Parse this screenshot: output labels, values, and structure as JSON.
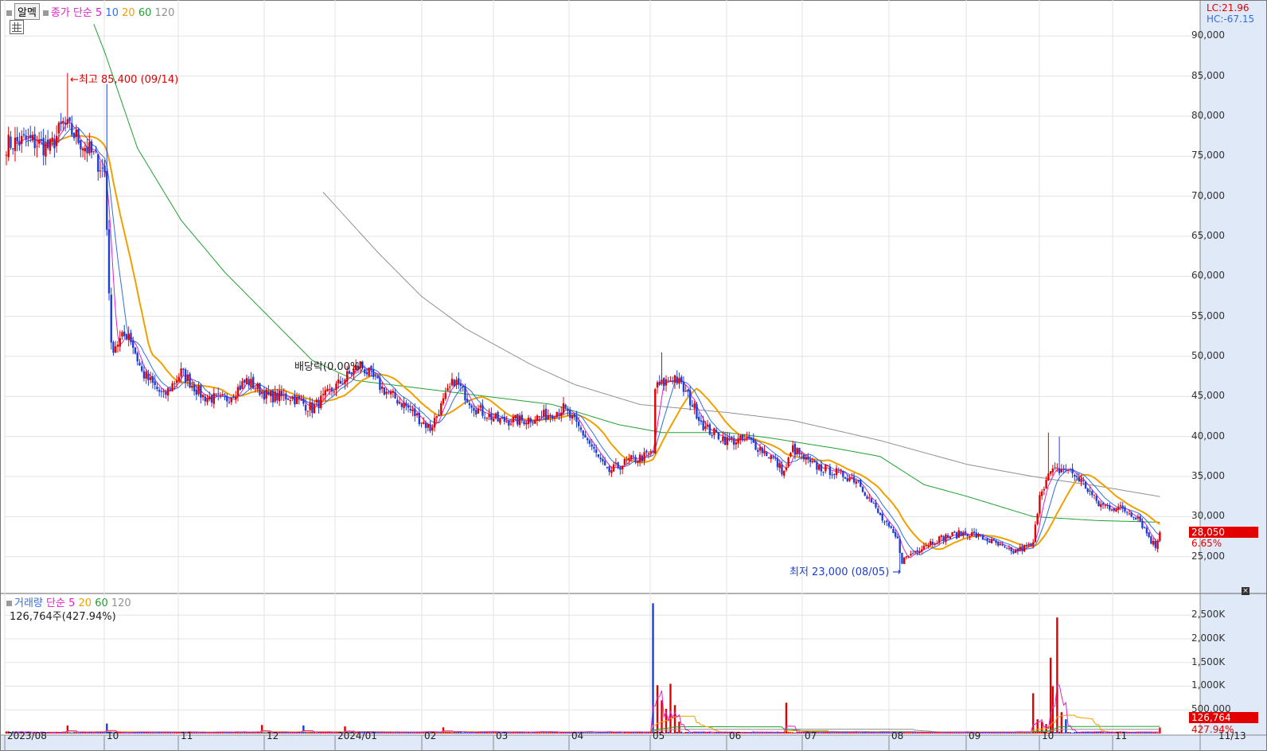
{
  "price_header": {
    "settings_label": "알멕",
    "title": "종가 단순",
    "ma_5": "5",
    "ma_10": "10",
    "ma_20": "20",
    "ma_60": "60",
    "ma_120": "120"
  },
  "volume_header": {
    "title": "거래량",
    "type": "단순",
    "ma_5": "5",
    "ma_20": "20",
    "ma_60": "60",
    "ma_120": "120",
    "latest": "126,764주(427.94%)"
  },
  "corner_stats": {
    "lc": "LC:21.96",
    "hc": "HC:-67.15"
  },
  "annotations": {
    "high": "←최고 85,400 (09/14)",
    "low": "최저 23,000 (08/05) →",
    "dividend": "배당락(0.00%)"
  },
  "current": {
    "price": "28,050",
    "change": "6.65%",
    "volume": "126,764",
    "volume_ratio": "427.94%"
  },
  "colors": {
    "up": "#e30000",
    "down": "#1d3fd6",
    "ma5": "#e020c8",
    "ma10": "#2f6fe0",
    "ma20": "#f0a000",
    "ma60": "#20a030",
    "ma120": "#909090",
    "axis_bg": "#dfe9f7"
  },
  "chart_data": {
    "type": "candlestick",
    "price_axis": {
      "ticks": [
        "90,000",
        "85,000",
        "80,000",
        "75,000",
        "70,000",
        "65,000",
        "60,000",
        "55,000",
        "50,000",
        "45,000",
        "40,000",
        "35,000",
        "30,000",
        "25,000"
      ],
      "ylim": [
        20600,
        94400
      ]
    },
    "volume_axis": {
      "ticks": [
        "2,500K",
        "2,000K",
        "1,500K",
        "1,000K",
        "500,000"
      ],
      "ylim": [
        0,
        2890000
      ]
    },
    "x_ticks": [
      "2023/08",
      "10",
      "11",
      "12",
      "2024/01",
      "02",
      "03",
      "04",
      "05",
      "06",
      "07",
      "08",
      "09",
      "10",
      "11",
      "11/13"
    ],
    "anchors": [
      {
        "d": 0,
        "c": 76500
      },
      {
        "d": 10,
        "c": 77000
      },
      {
        "d": 20,
        "c": 76000
      },
      {
        "d": 26,
        "c": 79000
      },
      {
        "d": 30,
        "c": 78000
      },
      {
        "d": 40,
        "c": 75000
      },
      {
        "d": 45,
        "c": 73000
      },
      {
        "d": 46,
        "c": 66000
      },
      {
        "d": 48,
        "c": 51000
      },
      {
        "d": 56,
        "c": 53000
      },
      {
        "d": 62,
        "c": 48000
      },
      {
        "d": 72,
        "c": 45000
      },
      {
        "d": 80,
        "c": 48000
      },
      {
        "d": 90,
        "c": 45000
      },
      {
        "d": 100,
        "c": 44500
      },
      {
        "d": 110,
        "c": 47000
      },
      {
        "d": 120,
        "c": 45000
      },
      {
        "d": 130,
        "c": 45000
      },
      {
        "d": 140,
        "c": 43500
      },
      {
        "d": 150,
        "c": 46000
      },
      {
        "d": 162,
        "c": 49000
      },
      {
        "d": 172,
        "c": 46000
      },
      {
        "d": 182,
        "c": 44000
      },
      {
        "d": 194,
        "c": 41000
      },
      {
        "d": 205,
        "c": 47000
      },
      {
        "d": 215,
        "c": 43500
      },
      {
        "d": 225,
        "c": 42000
      },
      {
        "d": 235,
        "c": 42000
      },
      {
        "d": 245,
        "c": 42500
      },
      {
        "d": 255,
        "c": 43500
      },
      {
        "d": 265,
        "c": 40000
      },
      {
        "d": 275,
        "c": 35500
      },
      {
        "d": 285,
        "c": 37000
      },
      {
        "d": 292,
        "c": 37500
      },
      {
        "d": 296,
        "c": 38000
      },
      {
        "d": 297,
        "c": 46000
      },
      {
        "d": 306,
        "c": 47500
      },
      {
        "d": 312,
        "c": 45000
      },
      {
        "d": 320,
        "c": 41000
      },
      {
        "d": 330,
        "c": 39500
      },
      {
        "d": 340,
        "c": 39500
      },
      {
        "d": 350,
        "c": 37500
      },
      {
        "d": 356,
        "c": 35500
      },
      {
        "d": 360,
        "c": 38500
      },
      {
        "d": 368,
        "c": 36500
      },
      {
        "d": 380,
        "c": 35500
      },
      {
        "d": 390,
        "c": 34500
      },
      {
        "d": 400,
        "c": 30000
      },
      {
        "d": 408,
        "c": 27000
      },
      {
        "d": 410,
        "c": 24500
      },
      {
        "d": 420,
        "c": 26500
      },
      {
        "d": 430,
        "c": 27500
      },
      {
        "d": 440,
        "c": 28000
      },
      {
        "d": 450,
        "c": 27000
      },
      {
        "d": 460,
        "c": 25500
      },
      {
        "d": 470,
        "c": 26500
      },
      {
        "d": 473,
        "c": 33000
      },
      {
        "d": 478,
        "c": 35500
      },
      {
        "d": 485,
        "c": 36000
      },
      {
        "d": 492,
        "c": 34500
      },
      {
        "d": 500,
        "c": 31500
      },
      {
        "d": 510,
        "c": 31000
      },
      {
        "d": 518,
        "c": 30000
      },
      {
        "d": 524,
        "c": 27000
      },
      {
        "d": 526,
        "c": 26300
      },
      {
        "d": 528,
        "c": 28050
      }
    ],
    "ma_anchors": {
      "ma120": [
        {
          "d": 145,
          "c": 70500
        },
        {
          "d": 170,
          "c": 63000
        },
        {
          "d": 190,
          "c": 57500
        },
        {
          "d": 210,
          "c": 53500
        },
        {
          "d": 240,
          "c": 49000
        },
        {
          "d": 260,
          "c": 46500
        },
        {
          "d": 290,
          "c": 44000
        },
        {
          "d": 330,
          "c": 43000
        },
        {
          "d": 360,
          "c": 42000
        },
        {
          "d": 400,
          "c": 39500
        },
        {
          "d": 440,
          "c": 36500
        },
        {
          "d": 470,
          "c": 35000
        },
        {
          "d": 500,
          "c": 33800
        },
        {
          "d": 528,
          "c": 32500
        }
      ],
      "ma60": [
        {
          "d": 40,
          "c": 91500
        },
        {
          "d": 45,
          "c": 88000
        },
        {
          "d": 60,
          "c": 76000
        },
        {
          "d": 80,
          "c": 67000
        },
        {
          "d": 100,
          "c": 60500
        },
        {
          "d": 120,
          "c": 55000
        },
        {
          "d": 140,
          "c": 49500
        },
        {
          "d": 160,
          "c": 47000
        },
        {
          "d": 190,
          "c": 46000
        },
        {
          "d": 220,
          "c": 45000
        },
        {
          "d": 250,
          "c": 44000
        },
        {
          "d": 280,
          "c": 41500
        },
        {
          "d": 300,
          "c": 40500
        },
        {
          "d": 330,
          "c": 40500
        },
        {
          "d": 350,
          "c": 39800
        },
        {
          "d": 380,
          "c": 38500
        },
        {
          "d": 400,
          "c": 37500
        },
        {
          "d": 420,
          "c": 34000
        },
        {
          "d": 440,
          "c": 32500
        },
        {
          "d": 470,
          "c": 30000
        },
        {
          "d": 500,
          "c": 29500
        },
        {
          "d": 528,
          "c": 29300
        }
      ]
    },
    "volume_events": [
      {
        "d": 296,
        "v": 2750000
      },
      {
        "d": 298,
        "v": 1020000
      },
      {
        "d": 300,
        "v": 700000
      },
      {
        "d": 302,
        "v": 520000
      },
      {
        "d": 304,
        "v": 1050000
      },
      {
        "d": 306,
        "v": 600000
      },
      {
        "d": 308,
        "v": 250000
      },
      {
        "d": 357,
        "v": 650000
      },
      {
        "d": 470,
        "v": 850000
      },
      {
        "d": 472,
        "v": 300000
      },
      {
        "d": 474,
        "v": 250000
      },
      {
        "d": 476,
        "v": 200000
      },
      {
        "d": 478,
        "v": 1600000
      },
      {
        "d": 479,
        "v": 1000000
      },
      {
        "d": 481,
        "v": 2450000
      },
      {
        "d": 483,
        "v": 450000
      },
      {
        "d": 485,
        "v": 300000
      },
      {
        "d": 46,
        "v": 210000
      },
      {
        "d": 28,
        "v": 170000
      },
      {
        "d": 117,
        "v": 180000
      },
      {
        "d": 136,
        "v": 170000
      },
      {
        "d": 155,
        "v": 150000
      },
      {
        "d": 200,
        "v": 130000
      },
      {
        "d": 528,
        "v": 126764
      }
    ]
  }
}
